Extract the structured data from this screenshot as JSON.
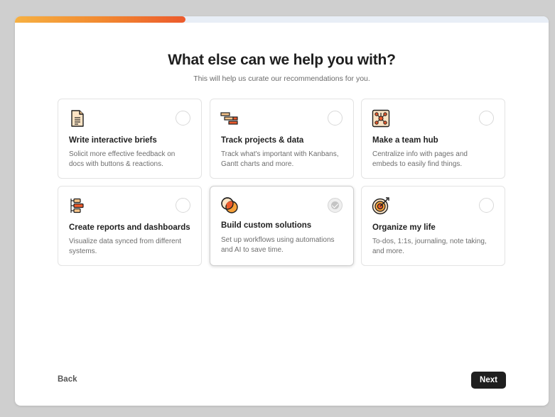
{
  "progress": {
    "value_percent": 32,
    "colors": [
      "#f6b042",
      "#ec5a2c"
    ]
  },
  "header": {
    "title": "What else can we help you with?",
    "subtitle": "This will help us curate our recommendations for you."
  },
  "options": [
    {
      "title": "Write interactive briefs",
      "description": "Solicit more effective feedback on docs with buttons & reactions.",
      "icon": "document-icon",
      "selected": false
    },
    {
      "title": "Track projects & data",
      "description": "Track what's important with Kanbans, Gantt charts and more.",
      "icon": "gantt-icon",
      "selected": false
    },
    {
      "title": "Make a team hub",
      "description": "Centralize info with pages and embeds to easily find things.",
      "icon": "network-icon",
      "selected": false
    },
    {
      "title": "Create reports and dashboards",
      "description": "Visualize data synced from different systems.",
      "icon": "data-flow-icon",
      "selected": false
    },
    {
      "title": "Build custom solutions",
      "description": "Set up workflows using automations and AI to save time.",
      "icon": "overlapping-circles-icon",
      "selected": true
    },
    {
      "title": "Organize my life",
      "description": "To-dos, 1:1s, journaling, note taking, and more.",
      "icon": "target-icon",
      "selected": false
    }
  ],
  "footer": {
    "back_label": "Back",
    "next_label": "Next"
  }
}
